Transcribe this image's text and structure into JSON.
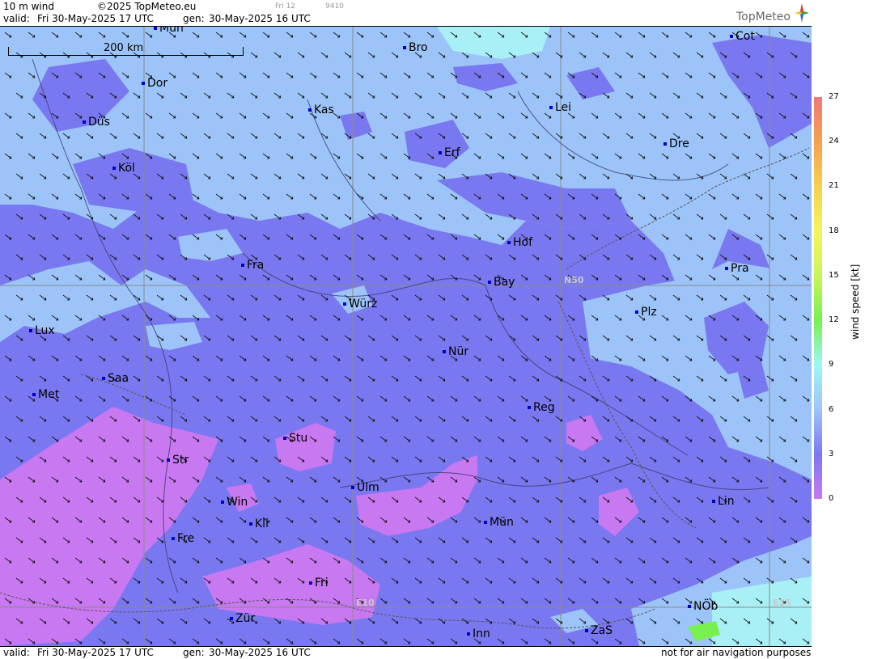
{
  "header": {
    "title": "10 m wind",
    "copyright": "©2025 TopMeteo.eu",
    "valid_label": "valid:",
    "valid": "Fri  30-May-2025  17 UTC",
    "gen_label": "gen:",
    "gen": "30-May-2025 16 UTC",
    "slot": "Fri 12",
    "code": "9410",
    "brand": "TopMeteo"
  },
  "footer": {
    "valid_label": "valid:",
    "valid": "Fri  30-May-2025  17 UTC",
    "gen_label": "gen:",
    "gen": "30-May-2025 16 UTC",
    "note": "not for air navigation purposes"
  },
  "scale": {
    "label": "200 km"
  },
  "grid_labels": {
    "n50": "N50",
    "e10": "E10",
    "e15": "E15"
  },
  "cities": [
    {
      "name": "Mün",
      "id": "city-muen-top"
    },
    {
      "name": "Bro",
      "id": "city-bro"
    },
    {
      "name": "Cot",
      "id": "city-cot"
    },
    {
      "name": "Dor",
      "id": "city-dor"
    },
    {
      "name": "Kas",
      "id": "city-kas"
    },
    {
      "name": "Lei",
      "id": "city-lei"
    },
    {
      "name": "Düs",
      "id": "city-dues"
    },
    {
      "name": "Dre",
      "id": "city-dre"
    },
    {
      "name": "Erf",
      "id": "city-erf"
    },
    {
      "name": "Köl",
      "id": "city-koel"
    },
    {
      "name": "Hof",
      "id": "city-hof"
    },
    {
      "name": "Fra",
      "id": "city-fra"
    },
    {
      "name": "Pra",
      "id": "city-pra"
    },
    {
      "name": "Bay",
      "id": "city-bay"
    },
    {
      "name": "Würz",
      "id": "city-wuer"
    },
    {
      "name": "Plz",
      "id": "city-plz"
    },
    {
      "name": "Lux",
      "id": "city-lux"
    },
    {
      "name": "Nür",
      "id": "city-nuer"
    },
    {
      "name": "Saa",
      "id": "city-saa"
    },
    {
      "name": "Met",
      "id": "city-met"
    },
    {
      "name": "Reg",
      "id": "city-reg"
    },
    {
      "name": "Stu",
      "id": "city-stu"
    },
    {
      "name": "Str",
      "id": "city-str"
    },
    {
      "name": "Ulm",
      "id": "city-ulm"
    },
    {
      "name": "Win",
      "id": "city-win"
    },
    {
      "name": "Lin",
      "id": "city-lin"
    },
    {
      "name": "Kli",
      "id": "city-kli"
    },
    {
      "name": "Mün",
      "id": "city-muen"
    },
    {
      "name": "Fre",
      "id": "city-fre"
    },
    {
      "name": "Fri",
      "id": "city-fri"
    },
    {
      "name": "NÖb",
      "id": "city-noeb"
    },
    {
      "name": "Zür",
      "id": "city-zuer"
    },
    {
      "name": "ZaS",
      "id": "city-zas"
    },
    {
      "name": "Inn",
      "id": "city-inn"
    }
  ],
  "legend": {
    "title": "wind speed [kt]",
    "ticks": [
      "27",
      "24",
      "21",
      "18",
      "15",
      "12",
      "9",
      "6",
      "3",
      "0"
    ],
    "colors": [
      "#f0787a",
      "#f5a050",
      "#f5d050",
      "#f5f55a",
      "#c8f55a",
      "#78f050",
      "#a0f5f5",
      "#9cc4f8",
      "#7a78f0",
      "#c878f0"
    ]
  }
}
